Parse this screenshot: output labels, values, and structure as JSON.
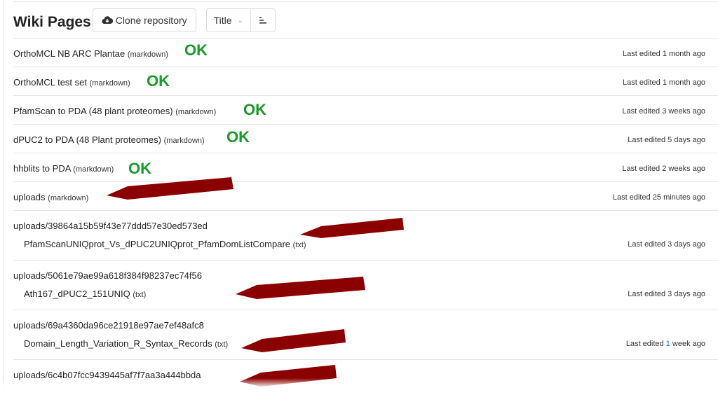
{
  "header": {
    "title": "Wiki Pages",
    "clone_label": "Clone repository",
    "sort_label": "Title"
  },
  "colors": {
    "ok": "#1a9a2a",
    "arrow": "#8b0000"
  },
  "pages": [
    {
      "name": "OrthoMCL NB ARC Plantae",
      "format": "(markdown)",
      "ok": "OK",
      "edited": "Last edited 1 month ago"
    },
    {
      "name": "OrthoMCL test set",
      "format": "(markdown)",
      "ok": "OK",
      "edited": "Last edited 1 month ago"
    },
    {
      "name": "PfamScan to PDA (48 plant proteomes)",
      "format": "(markdown)",
      "ok": "OK",
      "edited": "Last edited 3 weeks ago"
    },
    {
      "name": "dPUC2 to PDA (48 Plant proteomes)",
      "format": "(markdown)",
      "ok": "OK",
      "edited": "Last edited 5 days ago"
    },
    {
      "name": "hhblits to PDA",
      "format": "(markdown)",
      "ok": "OK",
      "edited": "Last edited 2 weeks ago"
    },
    {
      "name": "uploads",
      "format": "(markdown)",
      "edited": "Last edited 25 minutes ago"
    }
  ],
  "uploads": [
    {
      "dir": "uploads/39864a15b59f43e77ddd57e30ed573ed",
      "file": "PfamScanUNIQprot_Vs_dPUC2UNIQprot_PfamDomListCompare",
      "format": "(txt)",
      "edited": "Last edited 3 days ago"
    },
    {
      "dir": "uploads/5061e79ae99a618f384f98237ec74f56",
      "file": "Ath167_dPUC2_151UNIQ",
      "format": "(txt)",
      "edited": "Last edited 3 days ago"
    },
    {
      "dir": "uploads/69a4360da96ce21918e97ae7ef48afc8",
      "file": "Domain_Length_Variation_R_Syntax_Records",
      "format": "(txt)",
      "edited_prefix": "Last edited ",
      "edited_num": "1",
      "edited_suffix": " week ago"
    },
    {
      "dir": "uploads/6c4b07fcc9439445af7f7aa3a444bbda"
    }
  ]
}
